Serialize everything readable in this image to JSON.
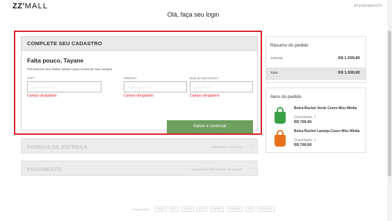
{
  "header": {
    "logo_bold": "ZZ",
    "logo_light": "MALL",
    "account_link": "ATENDIMENTO"
  },
  "page": {
    "title": "Olá, faça seu login"
  },
  "signup": {
    "section_title": "COMPLETE SEU CADASTRO",
    "greeting": "Falta pouco, Tayane",
    "intro": "Precisamos dos dados abaixo para continuar sua compra",
    "fields": [
      {
        "label": "CPF*",
        "placeholder": "___.___.___-__",
        "error": "Campo obrigatório"
      },
      {
        "label": "Telefone*",
        "placeholder": "(__) _____-____",
        "error": "Campo obrigatório"
      },
      {
        "label": "Data de nascimento*",
        "placeholder": "__/__/____",
        "error": "Campo obrigatório"
      }
    ],
    "save_button": "Salvar e continuar"
  },
  "delivery": {
    "title": "FORMAS DE ENTREGA",
    "status": "Aguardando endereço"
  },
  "payment": {
    "title": "PAGAMENTO",
    "status": "Aguardando informações de entrega"
  },
  "summary": {
    "title": "Resumo do pedido",
    "subtotal_label": "Subtotal",
    "subtotal_value": "R$ 1.599,80",
    "total_label": "Total",
    "total_value": "R$ 1.599,80"
  },
  "items": {
    "title": "Itens do pedido",
    "list": [
      {
        "name": "Bolsa Bucket Verde Couro Mizz Média",
        "quantity": "Quantidade: 1",
        "price": "R$ 799,90",
        "color": "#3aa046",
        "icon": "green-bag-icon"
      },
      {
        "name": "Bolsa Bucket Laranja Couro Mizz Média",
        "quantity": "Quantidade: 1",
        "price": "R$ 799,90",
        "color": "#e8711e",
        "icon": "orange-bag-icon"
      }
    ]
  },
  "footer": {
    "payments_label": "Pagamentos",
    "methods": [
      "VISA",
      "MC",
      "AMEX",
      "ELO",
      "HIPER",
      "DINERS",
      "PIX",
      "BOLETO"
    ]
  },
  "colors": {
    "error": "#d8202a",
    "save_button": "#6e9f5e",
    "highlight_border": "#d8202a"
  }
}
